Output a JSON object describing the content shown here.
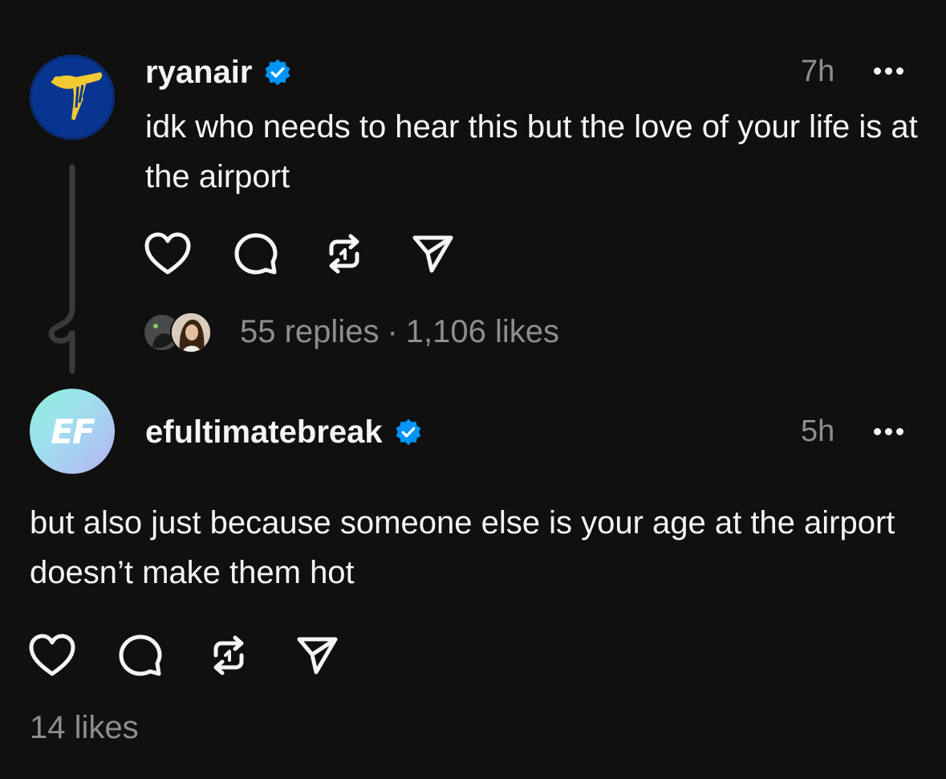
{
  "post": {
    "username": "ryanair",
    "verified": true,
    "time": "7h",
    "text": "idk who needs to hear this but the love of your life is at the airport",
    "replies_text": "55 replies",
    "separator": "·",
    "likes_text": "1,106 likes",
    "avatar_colors": {
      "bg": "#073590",
      "accent": "#f1c933"
    }
  },
  "reply": {
    "username": "efultimatebreak",
    "verified": true,
    "time": "5h",
    "text": "but also just because someone else is your age at the airport doesn’t make them hot",
    "likes_text": "14 likes",
    "avatar_text": "EF"
  },
  "icons": [
    "heart-icon",
    "comment-icon",
    "repost-icon",
    "share-icon",
    "more-icon",
    "verified-badge-icon"
  ],
  "colors": {
    "background": "#101010",
    "text": "#f3f5f7",
    "secondary": "#8e8e8e",
    "verified": "#0095f6",
    "thread_line": "#3a3a3a"
  }
}
